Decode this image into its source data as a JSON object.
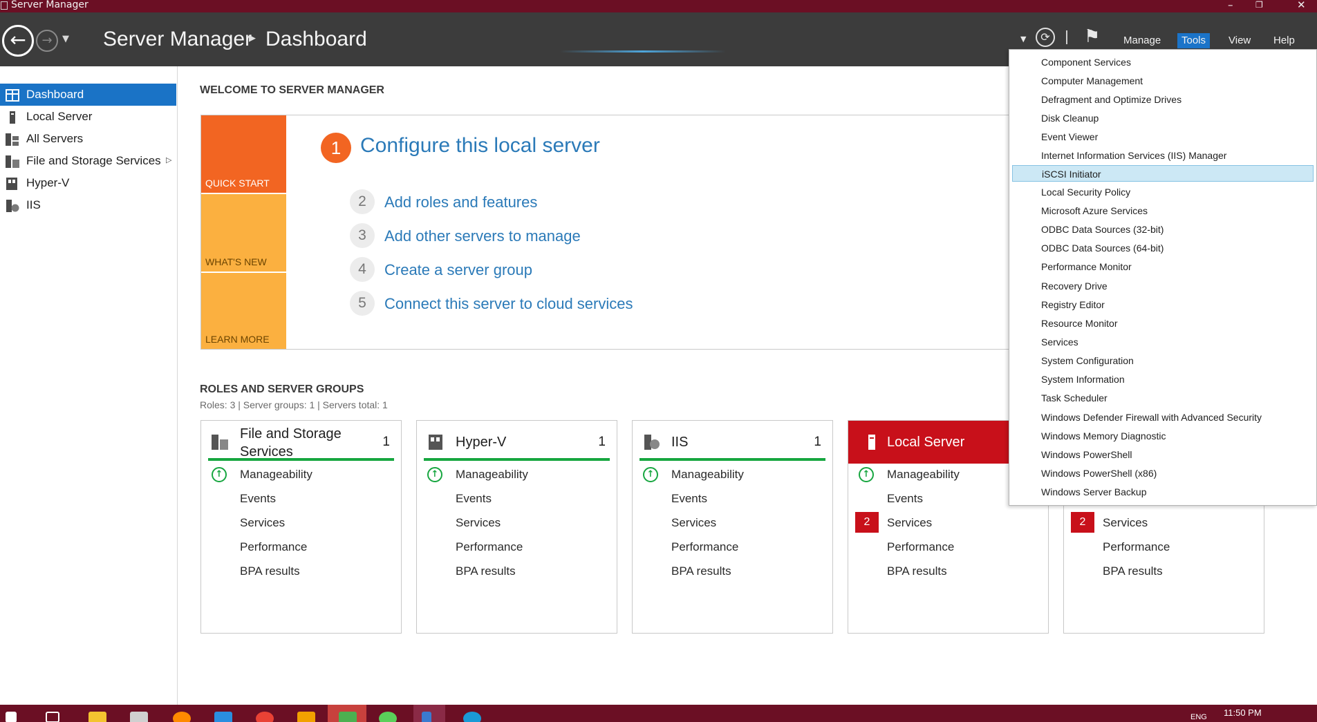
{
  "window": {
    "title": "Server Manager"
  },
  "header": {
    "app": "Server Manager",
    "page": "Dashboard",
    "menu": [
      "Manage",
      "Tools",
      "View",
      "Help"
    ],
    "active_menu": "Tools"
  },
  "sidebar": {
    "items": [
      {
        "label": "Dashboard",
        "icon": "dashboard-icon"
      },
      {
        "label": "Local Server",
        "icon": "server-icon"
      },
      {
        "label": "All Servers",
        "icon": "servers-icon"
      },
      {
        "label": "File and Storage Services",
        "icon": "file-storage-icon"
      },
      {
        "label": "Hyper-V",
        "icon": "hyperv-icon"
      },
      {
        "label": "IIS",
        "icon": "iis-icon"
      }
    ]
  },
  "welcome": {
    "heading": "WELCOME TO SERVER MANAGER",
    "tiles": [
      "QUICK START",
      "WHAT'S NEW",
      "LEARN MORE"
    ],
    "configure_number": "1",
    "configure_label": "Configure this local server",
    "steps": [
      {
        "num": "2",
        "label": "Add roles and features"
      },
      {
        "num": "3",
        "label": "Add other servers to manage"
      },
      {
        "num": "4",
        "label": "Create a server group"
      },
      {
        "num": "5",
        "label": "Connect this server to cloud services"
      }
    ]
  },
  "roles": {
    "heading": "ROLES AND SERVER GROUPS",
    "summary": "Roles: 3   |   Server groups: 1   |   Servers total: 1",
    "tiles": [
      {
        "title": "File and Storage Services",
        "count": "1",
        "rows": [
          "Manageability",
          "Events",
          "Services",
          "Performance",
          "BPA results"
        ]
      },
      {
        "title": "Hyper-V",
        "count": "1",
        "rows": [
          "Manageability",
          "Events",
          "Services",
          "Performance",
          "BPA results"
        ]
      },
      {
        "title": "IIS",
        "count": "1",
        "rows": [
          "Manageability",
          "Events",
          "Services",
          "Performance",
          "BPA results"
        ]
      },
      {
        "title": "Local Server",
        "count": "",
        "services_badge": "2",
        "rows": [
          "Manageability",
          "Events",
          "Services",
          "Performance",
          "BPA results"
        ]
      },
      {
        "title": "",
        "services_badge": "2",
        "rows": [
          "Services",
          "Performance",
          "BPA results"
        ]
      }
    ]
  },
  "tools_menu": {
    "items": [
      "Component Services",
      "Computer Management",
      "Defragment and Optimize Drives",
      "Disk Cleanup",
      "Event Viewer",
      "Internet Information Services (IIS) Manager",
      "iSCSI Initiator",
      "Local Security Policy",
      "Microsoft Azure Services",
      "ODBC Data Sources (32-bit)",
      "ODBC Data Sources (64-bit)",
      "Performance Monitor",
      "Recovery Drive",
      "Registry Editor",
      "Resource Monitor",
      "Services",
      "System Configuration",
      "System Information",
      "Task Scheduler",
      "Windows Defender Firewall with Advanced Security",
      "Windows Memory Diagnostic",
      "Windows PowerShell",
      "Windows PowerShell (x86)",
      "Windows Server Backup"
    ],
    "highlighted": "iSCSI Initiator"
  },
  "taskbar": {
    "clock": "11:50 PM",
    "lang": "ENG"
  },
  "colors": {
    "accent": "#1a73c6",
    "titlebar": "#6b0f24",
    "header": "#3c3c3c",
    "quickstart": "#f26522",
    "whatsnew": "#fbb040",
    "ok": "#17a640",
    "alert": "#c8101a"
  }
}
